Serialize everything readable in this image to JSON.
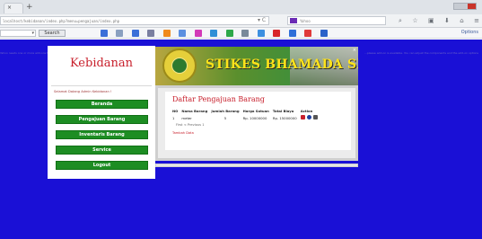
{
  "browser": {
    "tab_close": "×",
    "new_tab": "+",
    "url": "localhost/kebidanan/index.php?menu=pengajuan/index.php",
    "reload": "▾ C",
    "search_engine": "Yahoo",
    "nav_icons": [
      "⌕",
      "☆",
      "▣",
      "⬇",
      "⌂",
      "≡"
    ]
  },
  "toolbar": {
    "search_button": "Search",
    "options_label": "Options",
    "icon_colors": [
      "#3a6fd8",
      "#8aa0c0",
      "#3a6fd8",
      "#7a7fa0",
      "#f08a1c",
      "#5b8fe0",
      "#d23ab8",
      "#2f8fd6",
      "#2ea84a",
      "#7a8a9a",
      "#3c8fe0",
      "#d8262a",
      "#2f6fd8",
      "#e03a3a",
      "#2a62c9"
    ]
  },
  "notice": {
    "left": "Yahoo needs one or more add-ons to be installed. ...",
    "right": "...please add-on is available. You can adjust the components and the add-on options"
  },
  "sidebar": {
    "brand": "Kebidanan",
    "welcome": "Selamat Datang Admin Kebidanan !",
    "menu": [
      "Beranda",
      "Pengajuan Barang",
      "Inventaris Barang",
      "Service",
      "Logout"
    ]
  },
  "banner": {
    "title": "STIKES BHAMADA SLAWI"
  },
  "content": {
    "title": "Daftar Pengajuan Barang",
    "columns": [
      "NO",
      "Nama Barang",
      "Jumlah Barang",
      "Harga Satuan",
      "Total Biaya",
      "Action"
    ],
    "rows": [
      {
        "no": "1",
        "nama": "meter",
        "jumlah": "5",
        "harga": "Rp. 10000000",
        "total": "Rp. 15000000"
      }
    ],
    "pager": "First < Previous 1",
    "tambah": "Tambah Data"
  }
}
